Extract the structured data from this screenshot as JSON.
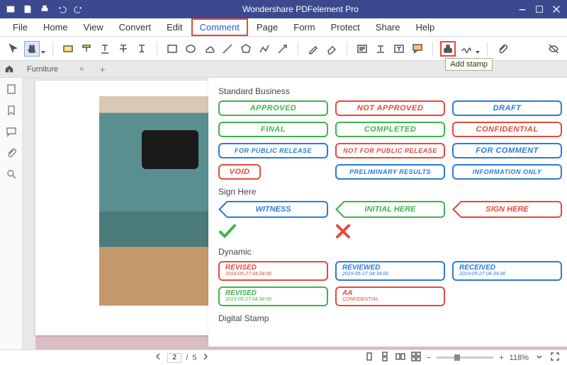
{
  "titlebar": {
    "title": "Wondershare PDFelement Pro"
  },
  "menu": [
    "File",
    "Home",
    "View",
    "Convert",
    "Edit",
    "Comment",
    "Page",
    "Form",
    "Protect",
    "Share",
    "Help"
  ],
  "menu_highlight_index": 5,
  "tooltip": "Add stamp",
  "tabs": {
    "home_icon": "home",
    "items": [
      {
        "label": "Furniture"
      }
    ]
  },
  "stamp_panel": {
    "sections": {
      "standard": {
        "title": "Standard Business",
        "stamps": [
          {
            "label": "APPROVED",
            "color": "green"
          },
          {
            "label": "NOT APPROVED",
            "color": "red"
          },
          {
            "label": "DRAFT",
            "color": "blue"
          },
          {
            "label": "FINAL",
            "color": "green"
          },
          {
            "label": "COMPLETED",
            "color": "green"
          },
          {
            "label": "CONFIDENTIAL",
            "color": "red"
          },
          {
            "label": "FOR PUBLIC RELEASE",
            "color": "blue",
            "small": true
          },
          {
            "label": "NOT FOR PUBLIC RELEASE",
            "color": "red",
            "small": true
          },
          {
            "label": "FOR COMMENT",
            "color": "blue"
          },
          {
            "label": "VOID",
            "color": "red"
          },
          {
            "label": "PRELIMINARY RESULTS",
            "color": "blue",
            "small": true
          },
          {
            "label": "INFORMATION ONLY",
            "color": "blue",
            "small": true
          }
        ]
      },
      "sign_here": {
        "title": "Sign Here",
        "arrows": [
          {
            "label": "WITNESS",
            "color": "blue"
          },
          {
            "label": "INITIAL HERE",
            "color": "green"
          },
          {
            "label": "SIGN HERE",
            "color": "red"
          }
        ],
        "marks": [
          "check",
          "x"
        ]
      },
      "dynamic": {
        "title": "Dynamic",
        "stamps": [
          {
            "title": "REVISED",
            "date": "2019-05-27 04:34:06",
            "color": "red"
          },
          {
            "title": "REVIEWED",
            "date": "2019-05-27 04:34:06",
            "color": "blue"
          },
          {
            "title": "RECEIVED",
            "date": "2019-05-27 04:34:06",
            "color": "blue"
          },
          {
            "title": "REVISED",
            "date": "2019-05-27 04:34:06",
            "color": "green"
          },
          {
            "title": "AA",
            "date": "CONFIDENTIAL",
            "color": "red"
          }
        ]
      },
      "digital": {
        "title": "Digital Stamp"
      }
    }
  },
  "statusbar": {
    "page_current": "2",
    "page_total": "5",
    "page_sep": "/",
    "zoom": "118%"
  },
  "icons": {
    "title_left": [
      "logo",
      "save",
      "print",
      "undo",
      "redo"
    ],
    "title_right": [
      "minimize",
      "maximize",
      "close"
    ],
    "sidebar": [
      "thumbnails",
      "bookmarks",
      "comments",
      "attachments",
      "search"
    ]
  }
}
